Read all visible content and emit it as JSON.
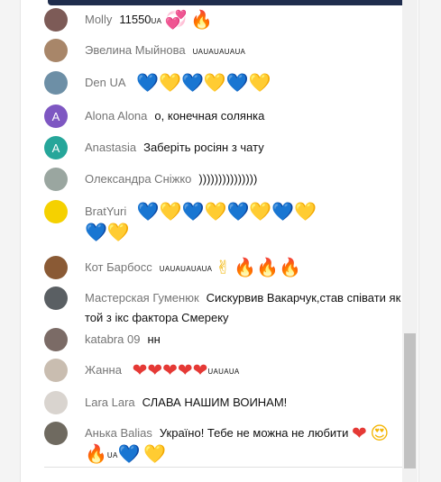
{
  "chat": {
    "messages": [
      {
        "author": "Molly",
        "text": "11550",
        "suffix": "UA",
        "avatar_initial": "",
        "avatar_color": "#7d5b57",
        "emojis": [
          "heart-sparkle",
          "fire"
        ]
      },
      {
        "author": "Эвелина Мыйнова",
        "text": "",
        "suffix": "UAUAUAUAUA",
        "avatar_initial": "",
        "avatar_color": "#a88669",
        "emojis": []
      },
      {
        "author": "Den UA",
        "text": "",
        "suffix": "",
        "avatar_initial": "",
        "avatar_color": "#6d8fa6",
        "emojis": [
          "blue-heart",
          "yellow-heart",
          "blue-heart",
          "yellow-heart",
          "blue-heart",
          "yellow-heart"
        ]
      },
      {
        "author": "Alona Alona",
        "text": "о, конечная солянка",
        "suffix": "",
        "avatar_initial": "A",
        "avatar_color": "#7e57c2",
        "emojis": []
      },
      {
        "author": "Anastasia",
        "text": "Заберіть росіян з чату",
        "suffix": "",
        "avatar_initial": "A",
        "avatar_color": "#26a69a",
        "emojis": []
      },
      {
        "author": "Олександра Сніжко",
        "text": ")))))))))))))))",
        "suffix": "",
        "avatar_initial": "",
        "avatar_color": "#9aa6a0",
        "emojis": []
      },
      {
        "author": "BratYuri",
        "text": "",
        "suffix": "",
        "avatar_initial": "",
        "avatar_color": "#f5d100",
        "emojis": [
          "blue-heart",
          "yellow-heart",
          "blue-heart",
          "yellow-heart",
          "blue-heart",
          "yellow-heart",
          "blue-heart",
          "yellow-heart",
          "blue-heart",
          "yellow-heart"
        ]
      },
      {
        "author": "Кот Барбосс",
        "text": "",
        "suffix": "UAUAUAUAUA",
        "avatar_initial": "",
        "avatar_color": "#8a5a35",
        "emojis": [
          "victory",
          "fire",
          "fire",
          "fire"
        ]
      },
      {
        "author": "Мастерская Гуменюк",
        "text": "Сискурвив Вакарчук,став співати як той з ікс фактора Смереку",
        "suffix": "",
        "avatar_initial": "",
        "avatar_color": "#5a5f63",
        "emojis": []
      },
      {
        "author": "katabra 09",
        "text": "нн",
        "suffix": "",
        "avatar_initial": "",
        "avatar_color": "#7b6b66",
        "emojis": []
      },
      {
        "author": "Жанна",
        "text": "",
        "suffix": "UAUAUA",
        "avatar_initial": "",
        "avatar_color": "#c9bdb0",
        "emojis": [
          "red-heart",
          "red-heart",
          "red-heart",
          "red-heart",
          "red-heart"
        ]
      },
      {
        "author": "Lara Lara",
        "text": "СЛАВА НАШИМ ВОИНАМ!",
        "suffix": "",
        "avatar_initial": "",
        "avatar_color": "#d9d4cf",
        "emojis": []
      },
      {
        "author": "Анька Balias",
        "text": "Україно! Тебе не можна не любити",
        "suffix": "UA",
        "avatar_initial": "",
        "avatar_color": "#6f6a60",
        "emojis": [
          "red-heart",
          "heart-eyes",
          "fire",
          "blue-heart",
          "yellow-heart"
        ]
      }
    ]
  },
  "colors": {
    "author": "#757575",
    "text": "#111111",
    "scroll_thumb": "#c1c1c1",
    "top_bar": "#1f2d4d"
  }
}
